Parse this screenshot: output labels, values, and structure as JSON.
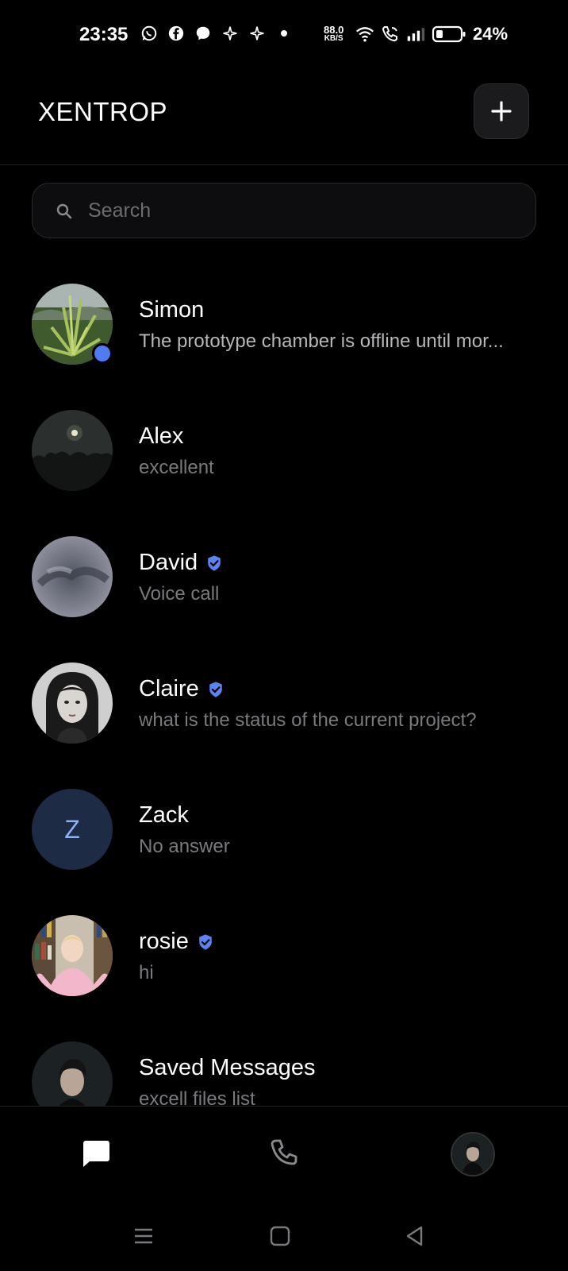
{
  "status_bar": {
    "time": "23:35",
    "net_speed_value": "88.0",
    "net_speed_unit": "KB/S",
    "battery_percent": "24%",
    "icons": [
      "whatsapp-icon",
      "facebook-icon",
      "messenger-icon",
      "sparkle-icon",
      "sparkle-icon",
      "dot-icon",
      "wifi-icon",
      "wifi-call-icon",
      "signal-icon",
      "battery-icon"
    ]
  },
  "header": {
    "title": "XENTROP",
    "add_button_icon": "plus-icon"
  },
  "search": {
    "placeholder": "Search",
    "value": ""
  },
  "chats": [
    {
      "name": "Simon",
      "preview": "The prototype chamber is offline until mor...",
      "verified": false,
      "online": true,
      "preview_style": "light"
    },
    {
      "name": "Alex",
      "preview": "excellent",
      "verified": false,
      "online": false
    },
    {
      "name": "David",
      "preview": "Voice call",
      "verified": true,
      "online": false
    },
    {
      "name": "Claire",
      "preview": "what is the status of the current project?",
      "verified": true,
      "online": false
    },
    {
      "name": "Zack",
      "preview": "No answer",
      "verified": false,
      "online": false,
      "initial": "Z"
    },
    {
      "name": "rosie",
      "preview": "hi",
      "verified": true,
      "online": false
    },
    {
      "name": "Saved Messages",
      "preview": "excell files list",
      "verified": false,
      "online": false
    }
  ],
  "bottom_nav": {
    "items": [
      "chats-icon",
      "phone-icon",
      "profile-avatar"
    ]
  },
  "colors": {
    "accent": "#4f7cf0",
    "background": "#000000",
    "muted_text": "#7a7a7e"
  }
}
